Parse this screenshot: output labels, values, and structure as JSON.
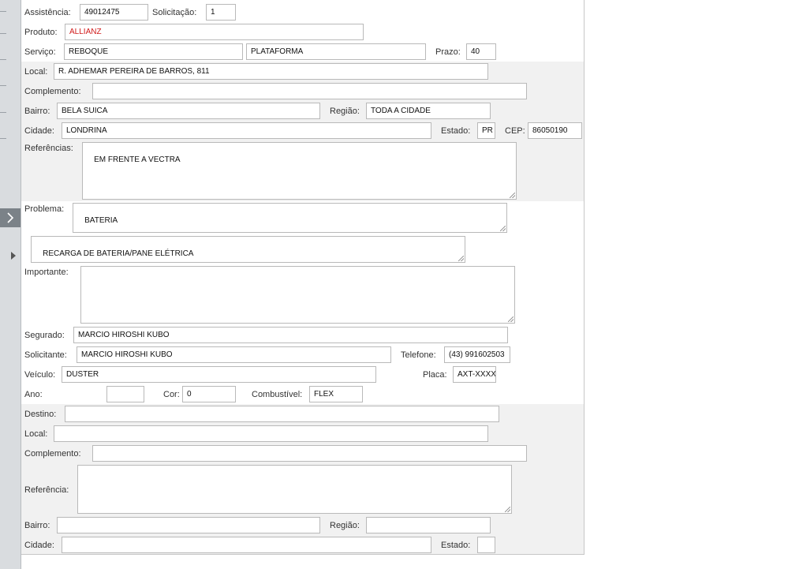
{
  "form": {
    "assistencia": {
      "label": "Assistência:",
      "value": "49012475"
    },
    "solicitacao": {
      "label": "Solicitação:",
      "value": "1"
    },
    "produto": {
      "label": "Produto:",
      "value": "ALLIANZ",
      "color": "#d01919"
    },
    "servico": {
      "label": "Serviço:",
      "value": "REBOQUE",
      "value2": "PLATAFORMA"
    },
    "prazo": {
      "label": "Prazo:",
      "value": "40"
    },
    "local": {
      "label": "Local:",
      "value": "R. ADHEMAR PEREIRA DE BARROS, 811"
    },
    "complemento": {
      "label": "Complemento:",
      "value": ""
    },
    "bairro": {
      "label": "Bairro:",
      "value": "BELA SUICA"
    },
    "regiao": {
      "label": "Região:",
      "value": "TODA A CIDADE"
    },
    "cidade": {
      "label": "Cidade:",
      "value": "LONDRINA"
    },
    "estado": {
      "label": "Estado:",
      "value": "PR"
    },
    "cep": {
      "label": "CEP:",
      "value": "86050190"
    },
    "referencias": {
      "label": "Referências:",
      "value": "EM FRENTE A VECTRA"
    },
    "problema": {
      "label": "Problema:",
      "value": "BATERIA",
      "detail": "RECARGA DE BATERIA/PANE ELÉTRICA"
    },
    "importante": {
      "label": "Importante:",
      "value": ""
    },
    "segurado": {
      "label": "Segurado:",
      "value": "MARCIO HIROSHI KUBO"
    },
    "solicitante": {
      "label": "Solicitante:",
      "value": "MARCIO HIROSHI KUBO"
    },
    "telefone": {
      "label": "Telefone:",
      "value": "(43) 991602503"
    },
    "veiculo": {
      "label": "Veículo:",
      "value": "DUSTER"
    },
    "placa": {
      "label": "Placa:",
      "value": "AXT-XXXX"
    },
    "ano": {
      "label": "Ano:",
      "value": ""
    },
    "cor": {
      "label": "Cor:",
      "value": "0"
    },
    "combustivel": {
      "label": "Combustível:",
      "value": "FLEX"
    }
  },
  "destino": {
    "destino": {
      "label": "Destino:",
      "value": ""
    },
    "local": {
      "label": "Local:",
      "value": ""
    },
    "complemento": {
      "label": "Complemento:",
      "value": ""
    },
    "referencia": {
      "label": "Referência:",
      "value": ""
    },
    "bairro": {
      "label": "Bairro:",
      "value": ""
    },
    "regiao": {
      "label": "Região:",
      "value": ""
    },
    "cidade": {
      "label": "Cidade:",
      "value": ""
    },
    "estado": {
      "label": "Estado:",
      "value": ""
    }
  },
  "icons": {
    "collapse": "chevron-right-icon",
    "row_marker": "caret-right-icon"
  },
  "colors": {
    "band_background": "#f1f1f1",
    "sidebar": "#d9dcdf",
    "handle": "#7b8288"
  }
}
